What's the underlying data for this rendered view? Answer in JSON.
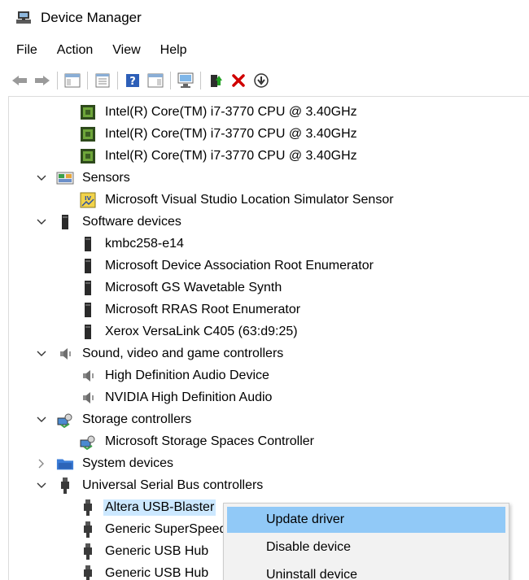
{
  "window": {
    "title": "Device Manager"
  },
  "menu": [
    "File",
    "Action",
    "View",
    "Help"
  ],
  "tree": [
    {
      "kind": "dev",
      "icon": "cpu-icon",
      "label": "Intel(R) Core(TM) i7-3770 CPU @ 3.40GHz"
    },
    {
      "kind": "dev",
      "icon": "cpu-icon",
      "label": "Intel(R) Core(TM) i7-3770 CPU @ 3.40GHz"
    },
    {
      "kind": "dev",
      "icon": "cpu-icon",
      "label": "Intel(R) Core(TM) i7-3770 CPU @ 3.40GHz"
    },
    {
      "kind": "cat",
      "expanded": true,
      "icon": "sensor-icon",
      "label": "Sensors"
    },
    {
      "kind": "dev",
      "icon": "sensor-device-icon",
      "label": "Microsoft Visual Studio Location Simulator Sensor"
    },
    {
      "kind": "cat",
      "expanded": true,
      "icon": "software-device-icon",
      "label": "Software devices"
    },
    {
      "kind": "dev",
      "icon": "software-device-icon",
      "label": "kmbc258-e14"
    },
    {
      "kind": "dev",
      "icon": "software-device-icon",
      "label": "Microsoft Device Association Root Enumerator"
    },
    {
      "kind": "dev",
      "icon": "software-device-icon",
      "label": "Microsoft GS Wavetable Synth"
    },
    {
      "kind": "dev",
      "icon": "software-device-icon",
      "label": "Microsoft RRAS Root Enumerator"
    },
    {
      "kind": "dev",
      "icon": "software-device-icon",
      "label": "Xerox VersaLink C405 (63:d9:25)"
    },
    {
      "kind": "cat",
      "expanded": true,
      "icon": "speaker-icon",
      "label": "Sound, video and game controllers"
    },
    {
      "kind": "dev",
      "icon": "speaker-icon",
      "label": "High Definition Audio Device"
    },
    {
      "kind": "dev",
      "icon": "speaker-icon",
      "label": "NVIDIA High Definition Audio"
    },
    {
      "kind": "cat",
      "expanded": true,
      "icon": "storage-icon",
      "label": "Storage controllers"
    },
    {
      "kind": "dev",
      "icon": "storage-icon",
      "label": "Microsoft Storage Spaces Controller"
    },
    {
      "kind": "cat",
      "expanded": false,
      "icon": "system-folder-icon",
      "label": "System devices"
    },
    {
      "kind": "cat",
      "expanded": true,
      "icon": "usb-plug-icon",
      "label": "Universal Serial Bus controllers"
    },
    {
      "kind": "dev",
      "icon": "usb-plug-icon",
      "label": "Altera USB-Blaster",
      "selected": true
    },
    {
      "kind": "dev",
      "icon": "usb-plug-icon",
      "label": "Generic SuperSpeed USB Hub"
    },
    {
      "kind": "dev",
      "icon": "usb-plug-icon",
      "label": "Generic USB Hub"
    },
    {
      "kind": "dev",
      "icon": "usb-plug-icon",
      "label": "Generic USB Hub"
    }
  ],
  "context_menu": {
    "items": [
      {
        "label": "Update driver",
        "highlighted": true
      },
      {
        "label": "Disable device"
      },
      {
        "label": "Uninstall device"
      }
    ]
  },
  "colors": {
    "selection": "#cce8ff",
    "menu_highlight": "#91c9f7",
    "delete_red": "#d00000",
    "accent_blue": "#0078d7"
  }
}
